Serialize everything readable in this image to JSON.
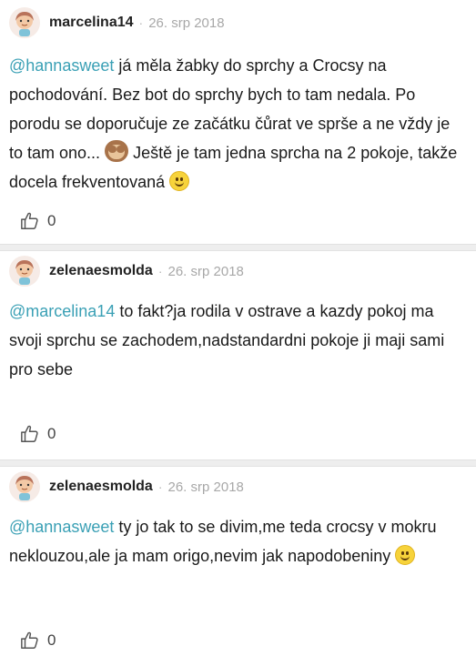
{
  "comments": [
    {
      "username": "marcelina14",
      "separator": "·",
      "date": "26. srp 2018",
      "mention": "@hannasweet",
      "text_before_emoji": " já měla žabky do sprchy a Crocsy na pochodování. Bez bot do sprchy bych to tam nedala. Po porodu se doporučuje ze začátku čůrat ve sprše a ne vždy je to tam ono... ",
      "text_after_emoji": " Ještě je tam jedna sprcha na 2 pokoje, takže docela frekventovaná ",
      "emojis": [
        "see-no-evil-monkey",
        "smiling-face"
      ],
      "likes": "0"
    },
    {
      "username": "zelenaesmolda",
      "separator": "·",
      "date": "26. srp 2018",
      "mention": "@marcelina14",
      "text": " to fakt?ja rodila v ostrave a kazdy pokoj ma svoji sprchu se zachodem,nadstandardni pokoje ji maji sami pro sebe",
      "likes": "0"
    },
    {
      "username": "zelenaesmolda",
      "separator": "·",
      "date": "26. srp 2018",
      "mention": "@hannasweet",
      "text": " ty jo tak to se divim,me teda crocsy v mokru neklouzou,ale ja mam origo,nevim jak napodobeniny ",
      "emojis": [
        "smiling-face"
      ],
      "likes": "0"
    }
  ],
  "colors": {
    "mention": "#3aa0b5",
    "separator_bg": "#eeeeee",
    "date": "#a8a8a8"
  }
}
